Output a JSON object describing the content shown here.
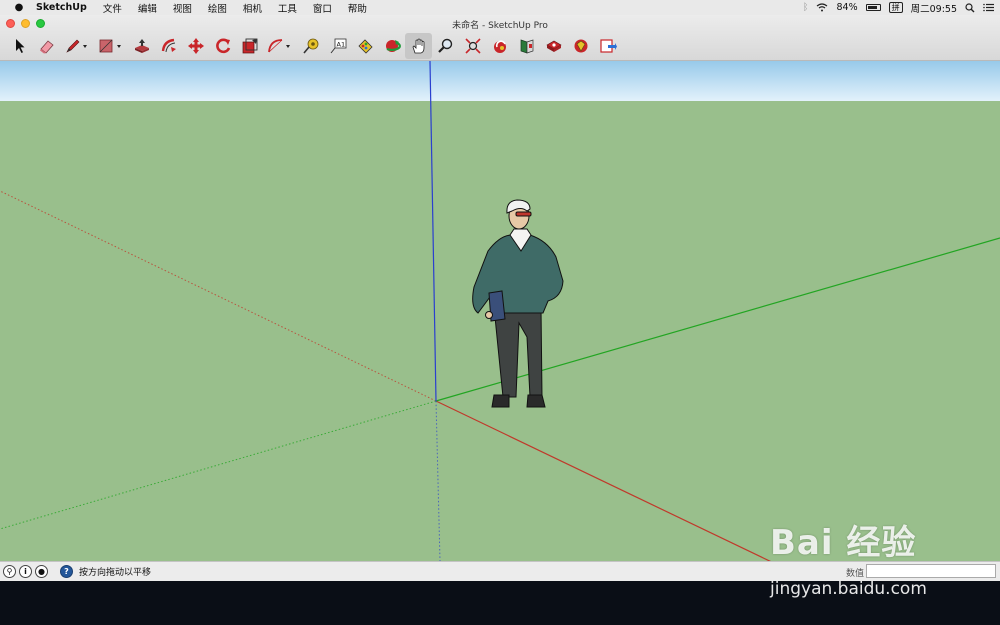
{
  "menubar": {
    "app_name": "SketchUp",
    "items": [
      "文件",
      "编辑",
      "视图",
      "绘图",
      "相机",
      "工具",
      "窗口",
      "帮助"
    ],
    "battery": "84%",
    "ime": "拼",
    "clock": "周二09:55"
  },
  "window": {
    "title": "未命名 - SketchUp Pro"
  },
  "toolbar": {
    "tools": [
      "select",
      "eraser",
      "pencil",
      "rectangle",
      "push-pull",
      "offset",
      "move",
      "rotate",
      "scale",
      "arc",
      "tape-measure",
      "text",
      "paint-bucket",
      "orbit",
      "pan",
      "zoom",
      "zoom-extents",
      "previous-view",
      "warehouse",
      "extension-warehouse",
      "layout",
      "3d-warehouse-share",
      "send-to-layout"
    ],
    "active_tool": "pan"
  },
  "statusbar": {
    "hint": "按方向拖动以平移",
    "measurements_label": "数值"
  },
  "watermark": {
    "logo": "Bai 经验",
    "url": "jingyan.baidu.com"
  },
  "colors": {
    "sky_top": "#97c9ea",
    "sky_bottom": "#e3f1fb",
    "ground": "#99bf8c",
    "red_axis": "#c0392b",
    "green_axis": "#22a522",
    "blue_axis": "#2a3fcf"
  }
}
